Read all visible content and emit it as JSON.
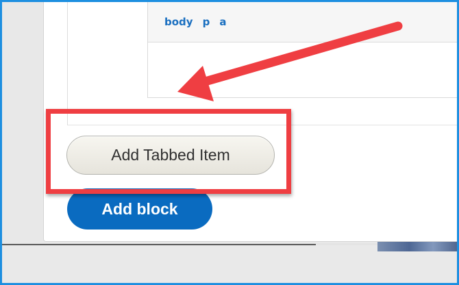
{
  "editor": {
    "element_path": [
      "body",
      "p",
      "a"
    ]
  },
  "buttons": {
    "add_tabbed_item": "Add Tabbed Item",
    "add_block": "Add block"
  },
  "annotation": {
    "color": "#ef3e42"
  },
  "colors": {
    "frame_border": "#1d8fe0",
    "primary_button": "#0a6bc0",
    "path_link": "#1a6fc0"
  }
}
